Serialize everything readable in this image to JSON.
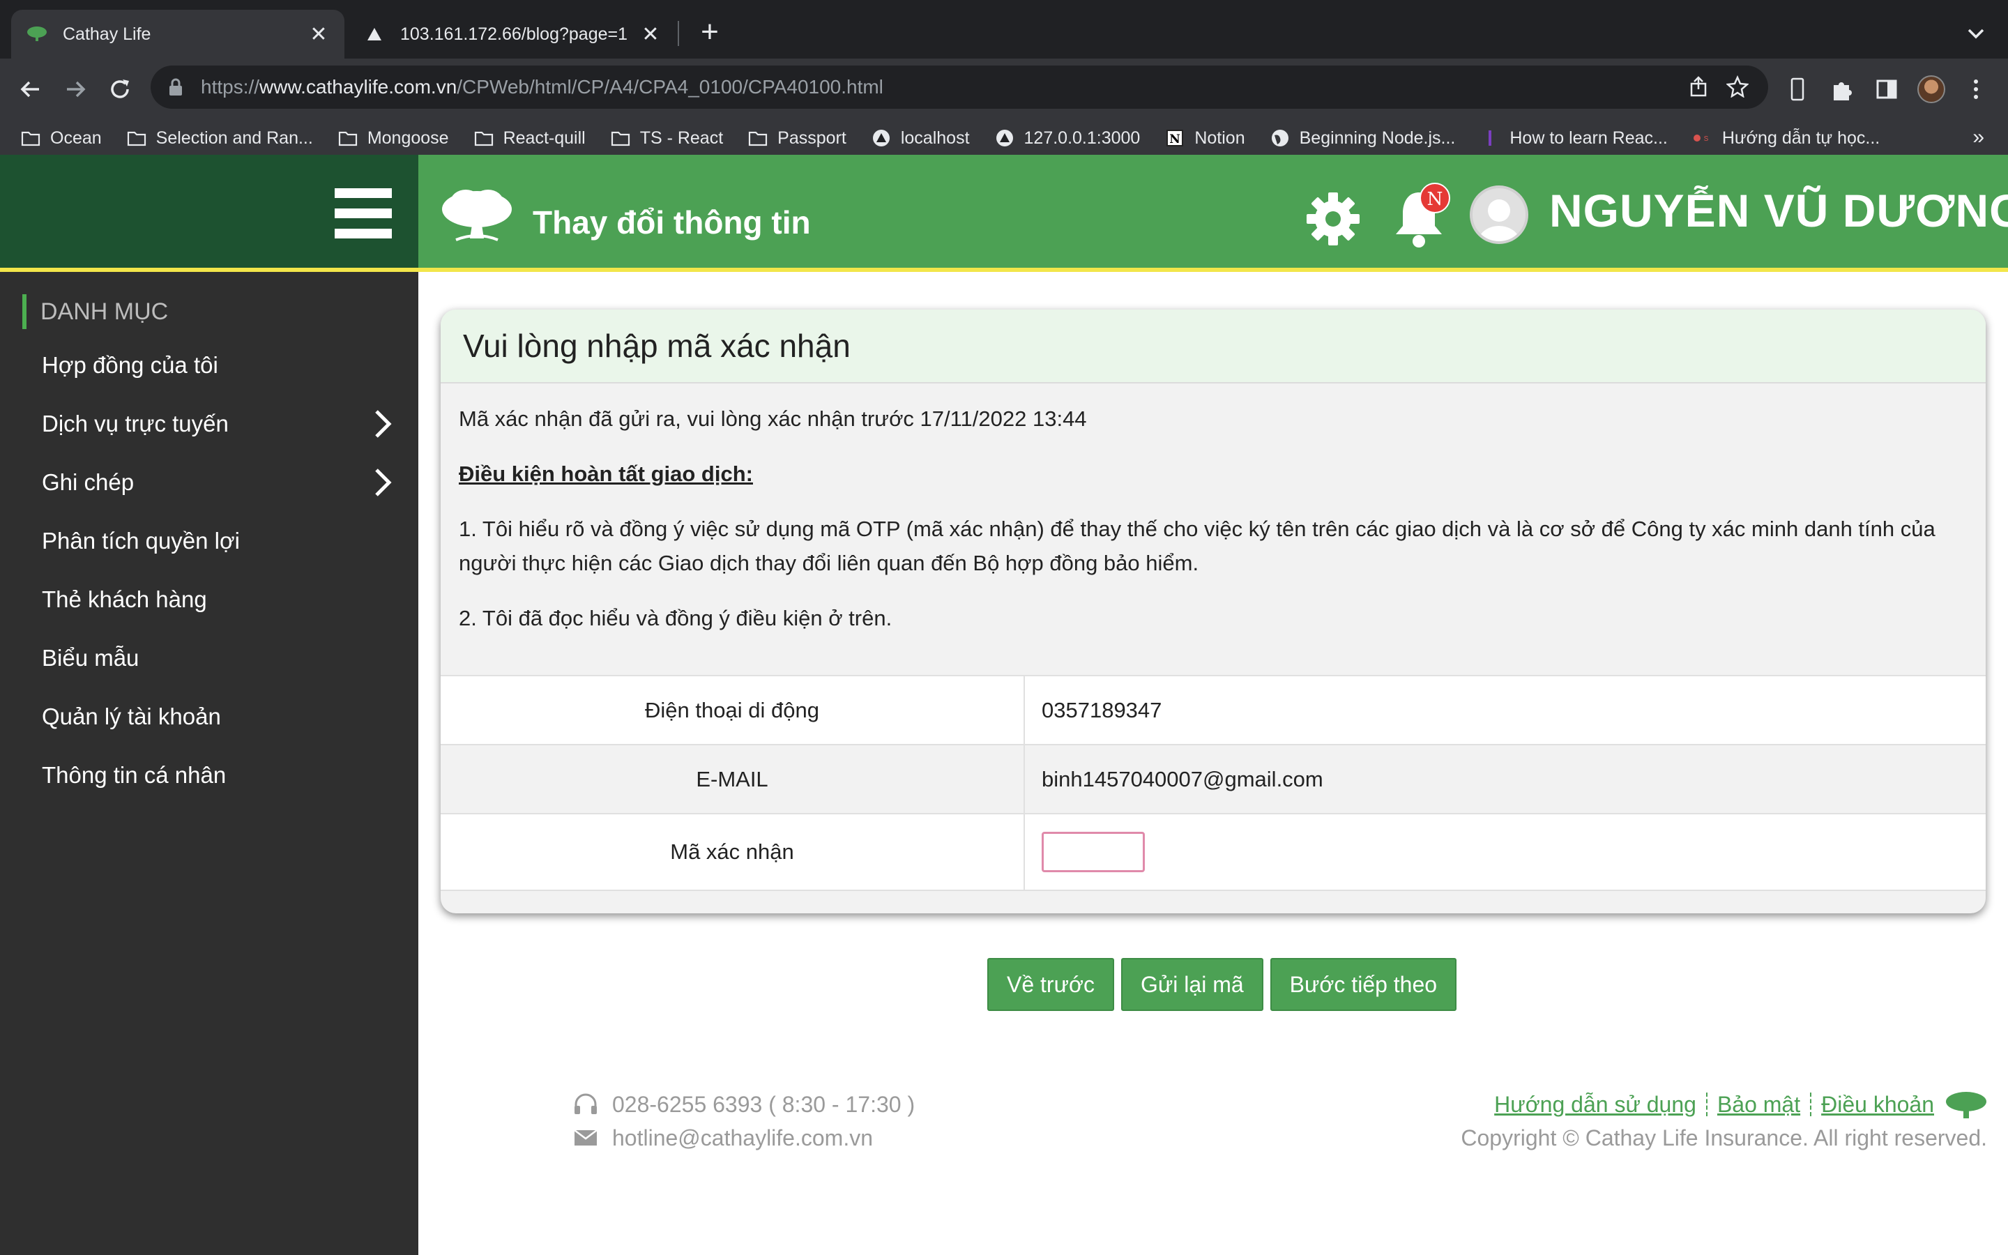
{
  "browser": {
    "tabs": [
      {
        "title": "Cathay Life",
        "active": true
      },
      {
        "title": "103.161.172.66/blog?page=1",
        "active": false
      }
    ],
    "url_prefix": "https://",
    "url_domain": "www.cathaylife.com.vn",
    "url_path": "/CPWeb/html/CP/A4/CPA4_0100/CPA40100.html",
    "bookmarks": [
      {
        "label": "Ocean",
        "icon": "folder-icon"
      },
      {
        "label": "Selection and Ran...",
        "icon": "folder-icon"
      },
      {
        "label": "Mongoose",
        "icon": "folder-icon"
      },
      {
        "label": "React-quill",
        "icon": "folder-icon"
      },
      {
        "label": "TS - React",
        "icon": "folder-icon"
      },
      {
        "label": "Passport",
        "icon": "folder-icon"
      },
      {
        "label": "localhost",
        "icon": "triangle-icon"
      },
      {
        "label": "127.0.0.1:3000",
        "icon": "triangle-icon"
      },
      {
        "label": "Notion",
        "icon": "notion-icon"
      },
      {
        "label": "Beginning Node.js...",
        "icon": "globe-icon"
      },
      {
        "label": "How to learn Reac...",
        "icon": "bar-icon"
      },
      {
        "label": "Hướng dẫn tự học...",
        "icon": "site-icon"
      }
    ],
    "more": "»"
  },
  "sidebar": {
    "title": "DANH MỤC",
    "items": [
      {
        "label": "Hợp đồng của tôi",
        "has_children": false
      },
      {
        "label": "Dịch vụ trực tuyến",
        "has_children": true
      },
      {
        "label": "Ghi chép",
        "has_children": true
      },
      {
        "label": "Phân tích quyền lợi",
        "has_children": false
      },
      {
        "label": "Thẻ khách hàng",
        "has_children": false
      },
      {
        "label": "Biểu mẫu",
        "has_children": false
      },
      {
        "label": "Quản lý tài khoản",
        "has_children": false
      },
      {
        "label": "Thông tin cá nhân",
        "has_children": false
      }
    ]
  },
  "header": {
    "page_title": "Thay đổi thông tin",
    "notification_badge": "N",
    "user_name": "NGUYỄN VŨ DƯƠNG"
  },
  "card": {
    "title": "Vui lòng nhập mã xác nhận",
    "notice": "Mã xác nhận đã gửi ra, vui lòng xác nhận trước 17/11/2022 13:44",
    "conditions_heading": "Điều kiện hoàn tất giao dịch:",
    "condition_1": "1. Tôi hiểu rõ và đồng ý việc sử dụng mã OTP (mã xác nhận) để thay thế cho việc ký tên trên các giao dịch và là cơ sở để Công ty xác minh danh tính của người thực hiện các Giao dịch thay đổi liên quan đến Bộ hợp đồng bảo hiểm.",
    "condition_2": "2. Tôi đã đọc hiểu và đồng ý điều kiện ở trên.",
    "fields": {
      "phone_label": "Điện thoại di động",
      "phone_value": "0357189347",
      "email_label": "E-MAIL",
      "email_value": "binh1457040007@gmail.com",
      "otp_label": "Mã xác nhận",
      "otp_value": ""
    }
  },
  "buttons": {
    "back": "Về trước",
    "resend": "Gửi lại mã",
    "next": "Bước tiếp theo"
  },
  "footer": {
    "phone": "028-6255 6393 ( 8:30 - 17:30 )",
    "email": "hotline@cathaylife.com.vn",
    "links": [
      "Hướng dẫn sử dụng",
      "Bảo mật",
      "Điều khoản"
    ],
    "copyright": "Copyright © Cathay Life Insurance. All right reserved."
  },
  "colors": {
    "brand_green": "#4ca154",
    "dark_green": "#1d5230",
    "accent_yellow": "#f2e64a",
    "sidebar_bg": "#2f2f2f"
  }
}
